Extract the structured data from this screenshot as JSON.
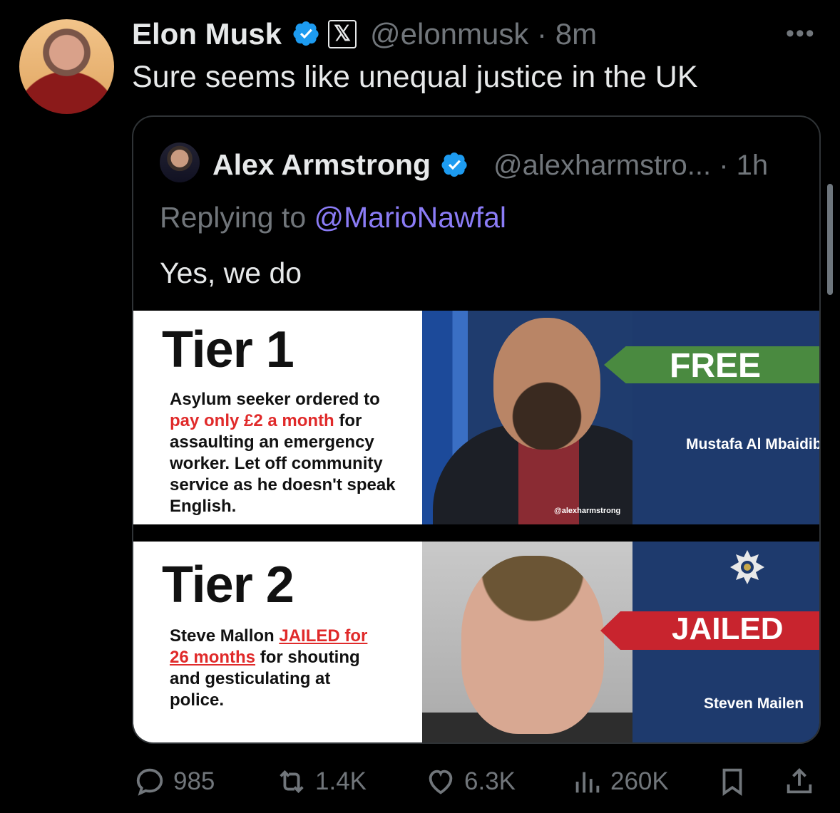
{
  "tweet": {
    "author_name": "Elon Musk",
    "x_badge": "𝕏",
    "handle_time": "@elonmusk · 8m",
    "more": "•••",
    "text": "Sure seems like unequal justice in the UK"
  },
  "quote": {
    "author_name": "Alex Armstrong",
    "handle_time": "@alexharmstro... · 1h",
    "replying_prefix": "Replying to ",
    "replying_to": "@MarioNawfal",
    "text": "Yes, we do",
    "panels": [
      {
        "tier": "Tier 1",
        "desc_pre": "Asylum seeker ordered to ",
        "desc_red": "pay only £2 a month",
        "desc_post": " for assaulting an emergency worker. Let off community service as he doesn't speak English.",
        "verdict": "FREE",
        "person": "Mustafa Al Mbaidib",
        "watermark": "@alexharmstrong"
      },
      {
        "tier": "Tier 2",
        "desc_pre": "Steve Mallon ",
        "desc_red": "JAILED for 26 months",
        "desc_post": " for shouting and gesticulating at police.",
        "verdict": "JAILED",
        "person": "Steven Mailen"
      }
    ]
  },
  "actions": {
    "replies": "985",
    "reposts": "1.4K",
    "likes": "6.3K",
    "views": "260K"
  },
  "colors": {
    "verified": "#1d9bf0",
    "mention": "#8b7cf6",
    "muted": "#71767b"
  }
}
